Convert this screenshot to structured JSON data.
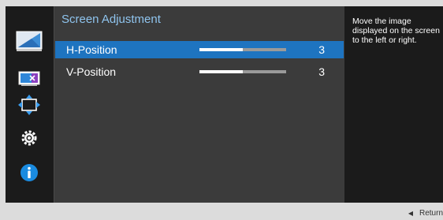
{
  "menu": {
    "icons": [
      "picture-icon",
      "color-icon",
      "size-position-icon",
      "setup-icon",
      "information-icon"
    ],
    "selected_index": 2
  },
  "panel": {
    "title": "Screen Adjustment",
    "items": [
      {
        "label": "H-Position",
        "value": "3",
        "level_percent": 50,
        "selected": true
      },
      {
        "label": "V-Position",
        "value": "3",
        "level_percent": 50,
        "selected": false
      }
    ]
  },
  "help": {
    "text": "Move the image displayed on the screen to the left or right."
  },
  "footer": {
    "return_label": "Return",
    "return_icon": "left-triangle-icon"
  },
  "colors": {
    "accent": "#1e74c0",
    "title": "#8fc4ee",
    "info": "#1a8be0"
  }
}
